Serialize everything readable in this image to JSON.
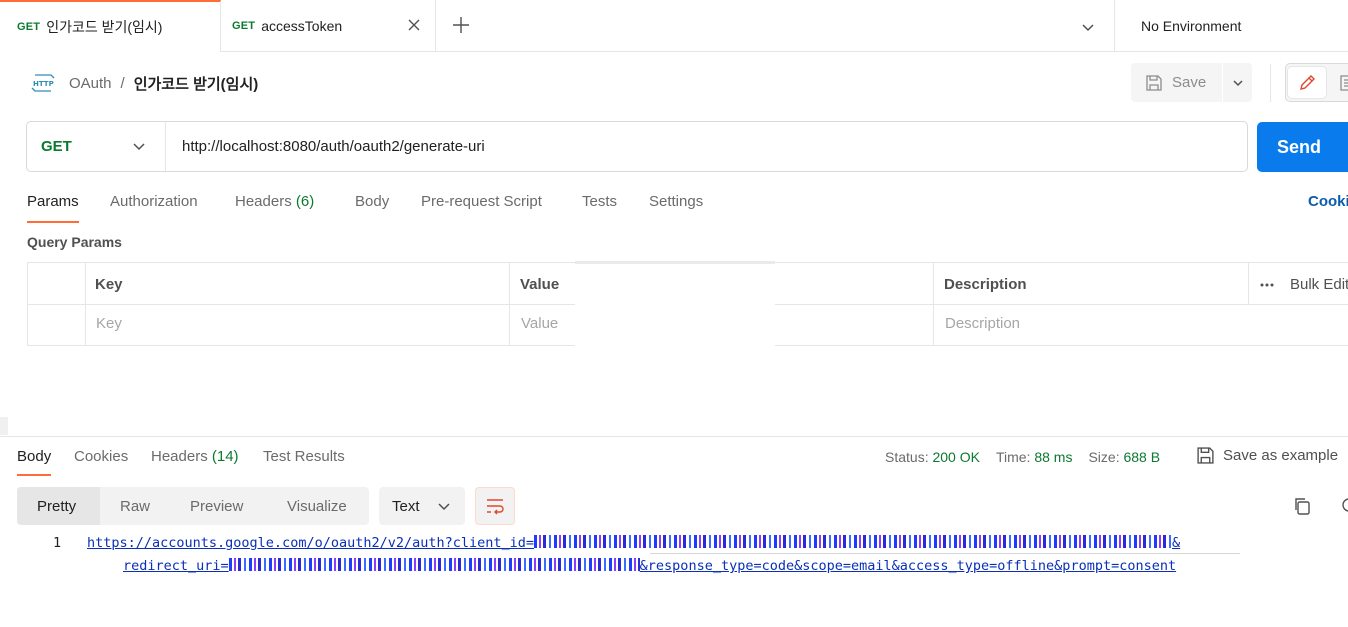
{
  "tabs": [
    {
      "method": "GET",
      "label": "인가코드 받기(임시)",
      "active": true
    },
    {
      "method": "GET",
      "label": "accessToken",
      "active": false
    }
  ],
  "environment": "No Environment",
  "breadcrumb": {
    "parent": "OAuth",
    "separator": "/",
    "current": "인가코드 받기(임시)"
  },
  "toolbar": {
    "save_label": "Save"
  },
  "request": {
    "method": "GET",
    "url": "http://localhost:8080/auth/oauth2/generate-uri",
    "send_label": "Send"
  },
  "request_tabs": {
    "params": "Params",
    "authorization": "Authorization",
    "headers": "Headers",
    "headers_count": "(6)",
    "body": "Body",
    "prerequest": "Pre-request Script",
    "tests": "Tests",
    "settings": "Settings",
    "cookies": "Cookies"
  },
  "query_params": {
    "title": "Query Params",
    "columns": {
      "key": "Key",
      "value": "Value",
      "description": "Description"
    },
    "bulk_edit": "Bulk Edit",
    "placeholders": {
      "key": "Key",
      "value": "Value",
      "description": "Description"
    }
  },
  "response_tabs": {
    "body": "Body",
    "cookies": "Cookies",
    "headers": "Headers",
    "headers_count": "(14)",
    "test_results": "Test Results"
  },
  "response_status": {
    "status_label": "Status:",
    "status_value": "200 OK",
    "time_label": "Time:",
    "time_value": "88 ms",
    "size_label": "Size:",
    "size_value": "688 B",
    "save_example": "Save as example"
  },
  "format": {
    "pretty": "Pretty",
    "raw": "Raw",
    "preview": "Preview",
    "visualize": "Visualize",
    "type": "Text"
  },
  "response_body": {
    "line_number": "1",
    "line1_prefix": "https://accounts.google.com/o/oauth2/v2/auth?client_id=",
    "line1_suffix": "&",
    "line2_prefix": "redirect_uri=",
    "line2_suffix": "&response_type=code&scope=email&access_type=offline&prompt=consent"
  },
  "colors": {
    "accent": "#ff6c37",
    "send": "#097bed",
    "get": "#0b7a2f",
    "link": "#0a2fb8"
  }
}
